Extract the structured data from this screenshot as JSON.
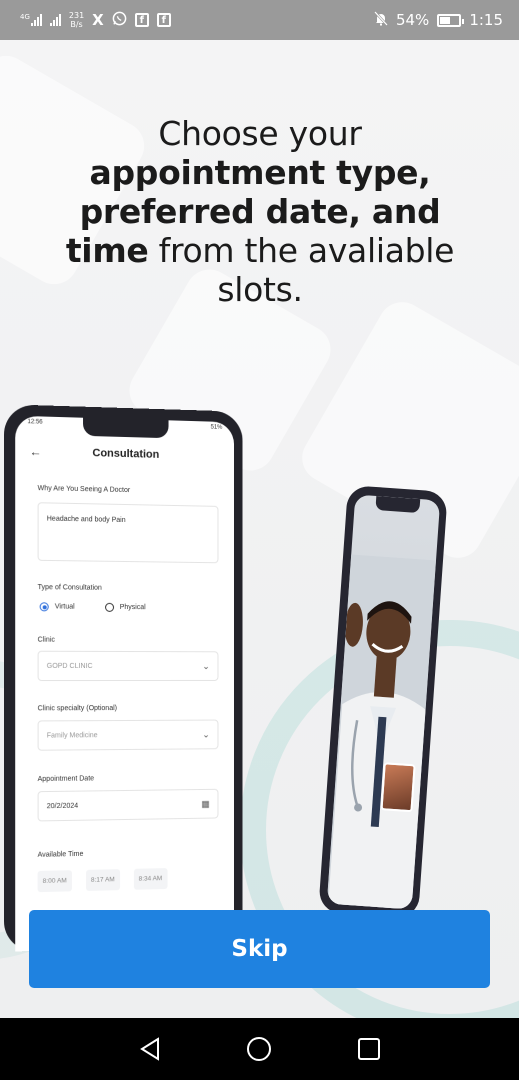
{
  "status_bar": {
    "network_tag": "4G",
    "data_speed_value": "231",
    "data_speed_unit": "B/s",
    "notification_icons": [
      "x-icon",
      "whatsapp-icon",
      "facebook-icon",
      "facebook-icon"
    ],
    "battery_percent": "54%",
    "battery_level": 0.54,
    "time": "1:15"
  },
  "onboarding": {
    "headline_line1": "Choose your",
    "headline_line2": "appointment type,",
    "headline_line3": "preferred date, and",
    "headline_line4_bold": "time",
    "headline_line4_rest": " from the avaliable",
    "headline_line5": "slots."
  },
  "mockup": {
    "status_time": "12:56",
    "status_right": "51%",
    "title": "Consultation",
    "reason_label": "Why Are You Seeing A Doctor",
    "reason_value": "Headache and body Pain",
    "consult_type_label": "Type of Consultation",
    "option_virtual": "Virtual",
    "option_physical": "Physical",
    "clinic_label": "Clinic",
    "clinic_value": "GOPD CLINIC",
    "specialty_label": "Clinic specialty  (Optional)",
    "specialty_value": "Family Medicine",
    "date_label": "Appointment Date",
    "date_value": "20/2/2024",
    "time_label": "Available Time",
    "time_slots": [
      "8:00 AM",
      "8:17 AM",
      "8:34 AM"
    ]
  },
  "skip_button": {
    "label": "Skip",
    "color": "#1f82e0"
  },
  "colors": {
    "status_bar": "#9a9a9a",
    "nav_bar": "#000000",
    "accent": "#1f82e0"
  }
}
